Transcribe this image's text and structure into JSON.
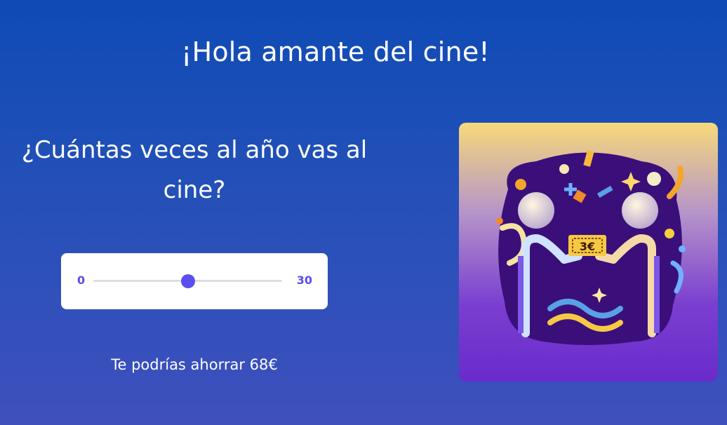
{
  "greeting": "¡Hola amante del cine!",
  "question": "¿Cuántas veces al año vas al cine?",
  "slider": {
    "min_label": "0",
    "max_label": "30",
    "min": 0,
    "max": 30,
    "value": 15,
    "accent_color": "#5b4ef0"
  },
  "savings_text": "Te podrías ahorrar 68€",
  "illustration": {
    "ticket_label": "3€",
    "icon": "cinema-ticket-illustration"
  },
  "colors": {
    "background_top": "#0f4bb5",
    "background_bottom": "#3f50bd",
    "card_background": "#ffffff"
  }
}
